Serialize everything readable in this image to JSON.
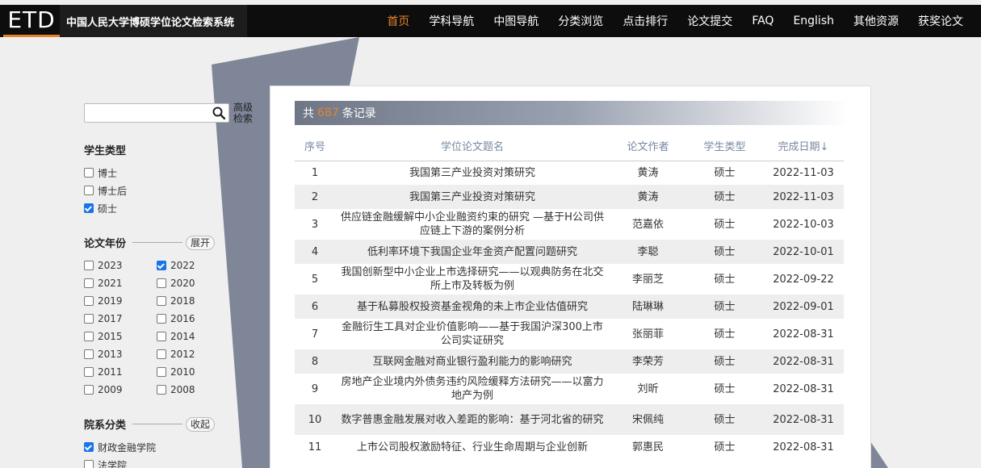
{
  "header": {
    "logo": "ETD",
    "site_title": "中国人民大学博硕学位论文检索系统",
    "nav": [
      "首页",
      "学科导航",
      "中图导航",
      "分类浏览",
      "点击排行",
      "论文提交",
      "FAQ",
      "English",
      "其他资源",
      "获奖论文"
    ],
    "active_nav": 0
  },
  "sidebar": {
    "search": {
      "value": "",
      "placeholder": ""
    },
    "advanced_search": "高级检索",
    "student_type": {
      "title": "学生类型",
      "items": [
        {
          "label": "博士",
          "checked": false
        },
        {
          "label": "博士后",
          "checked": false
        },
        {
          "label": "硕士",
          "checked": true
        }
      ]
    },
    "year": {
      "title": "论文年份",
      "toggle": "展开",
      "items": [
        {
          "label": "2023",
          "checked": false
        },
        {
          "label": "2022",
          "checked": true
        },
        {
          "label": "2021",
          "checked": false
        },
        {
          "label": "2020",
          "checked": false
        },
        {
          "label": "2019",
          "checked": false
        },
        {
          "label": "2018",
          "checked": false
        },
        {
          "label": "2017",
          "checked": false
        },
        {
          "label": "2016",
          "checked": false
        },
        {
          "label": "2015",
          "checked": false
        },
        {
          "label": "2014",
          "checked": false
        },
        {
          "label": "2013",
          "checked": false
        },
        {
          "label": "2012",
          "checked": false
        },
        {
          "label": "2011",
          "checked": false
        },
        {
          "label": "2010",
          "checked": false
        },
        {
          "label": "2009",
          "checked": false
        },
        {
          "label": "2008",
          "checked": false
        }
      ]
    },
    "department": {
      "title": "院系分类",
      "toggle": "收起",
      "items": [
        {
          "label": "财政金融学院",
          "checked": true
        },
        {
          "label": "法学院",
          "checked": false
        }
      ]
    }
  },
  "results": {
    "prefix": "共",
    "count": "687",
    "suffix": "条记录",
    "columns": [
      "序号",
      "学位论文题名",
      "论文作者",
      "学生类型",
      "完成日期↓"
    ],
    "rows": [
      {
        "no": "1",
        "title": "我国第三产业投资对策研究",
        "author": "黄涛",
        "type": "硕士",
        "date": "2022-11-03"
      },
      {
        "no": "2",
        "title": "我国第三产业投资对策研究",
        "author": "黄涛",
        "type": "硕士",
        "date": "2022-11-03"
      },
      {
        "no": "3",
        "title": "供应链金融缓解中小企业融资约束的研究 —基于H公司供应链上下游的案例分析",
        "author": "范嘉依",
        "type": "硕士",
        "date": "2022-10-03"
      },
      {
        "no": "4",
        "title": "低利率环境下我国企业年金资产配置问题研究",
        "author": "李聪",
        "type": "硕士",
        "date": "2022-10-01"
      },
      {
        "no": "5",
        "title": "我国创新型中小企业上市选择研究——以观典防务在北交所上市及转板为例",
        "author": "李丽芝",
        "type": "硕士",
        "date": "2022-09-22"
      },
      {
        "no": "6",
        "title": "基于私募股权投资基金视角的未上市企业估值研究",
        "author": "陆琳琳",
        "type": "硕士",
        "date": "2022-09-01"
      },
      {
        "no": "7",
        "title": "金融衍生工具对企业价值影响——基于我国沪深300上市公司实证研究",
        "author": "张丽菲",
        "type": "硕士",
        "date": "2022-08-31"
      },
      {
        "no": "8",
        "title": "互联网金融对商业银行盈利能力的影响研究",
        "author": "李荣芳",
        "type": "硕士",
        "date": "2022-08-31"
      },
      {
        "no": "9",
        "title": "房地产企业境内外债务违约风险缓释方法研究——以富力地产为例",
        "author": "刘昕",
        "type": "硕士",
        "date": "2022-08-31"
      },
      {
        "no": "10",
        "title": "数字普惠金融发展对收入差距的影响：基于河北省的研究",
        "author": "宋佩纯",
        "type": "硕士",
        "date": "2022-08-31"
      },
      {
        "no": "11",
        "title": "上市公司股权激励特征、行业生命周期与企业创新",
        "author": "郭惠民",
        "type": "硕士",
        "date": "2022-08-31"
      }
    ]
  },
  "colors": {
    "accent": "#e6822b",
    "header_bg": "#0d0d0d",
    "checkbox": "#1a73e8"
  }
}
